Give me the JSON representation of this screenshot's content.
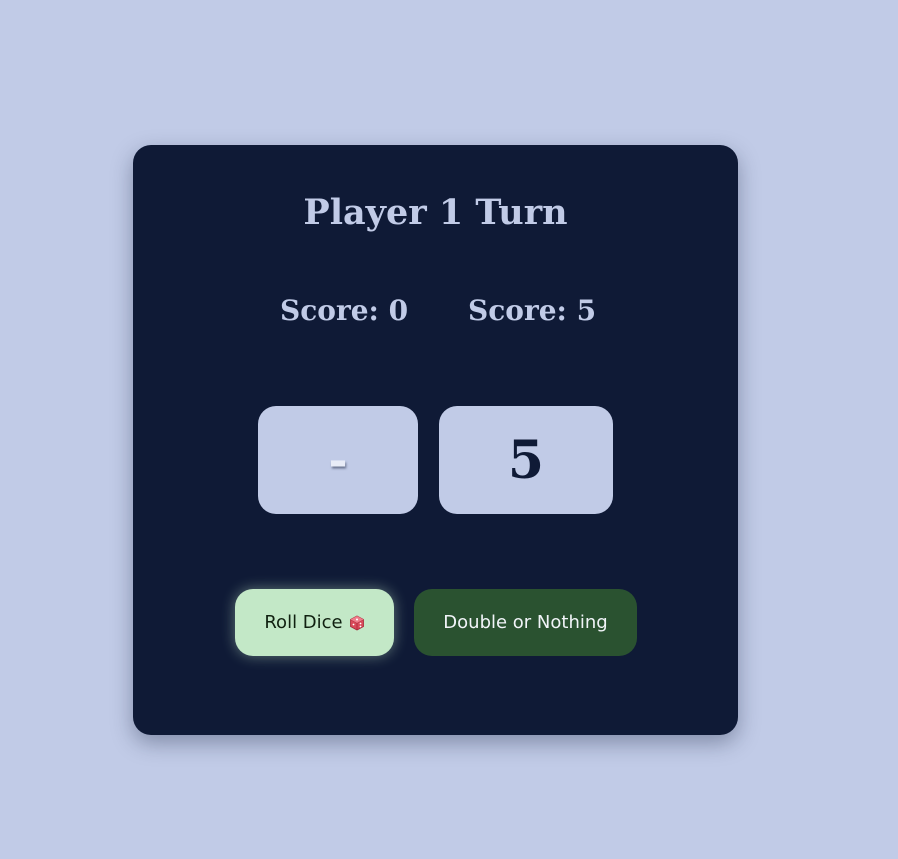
{
  "game": {
    "turn_title": "Player 1 Turn",
    "players": [
      {
        "score_label": "Score: 0",
        "die_value": "-"
      },
      {
        "score_label": "Score: 5",
        "die_value": "5"
      }
    ]
  },
  "controls": {
    "roll_label": "Roll Dice",
    "roll_icon": "dice-icon",
    "double_label": "Double or Nothing"
  },
  "colors": {
    "background": "#c1cbe7",
    "card": "#0f1a36",
    "roll_button": "#c3e8c7",
    "double_button": "#2a5230"
  }
}
